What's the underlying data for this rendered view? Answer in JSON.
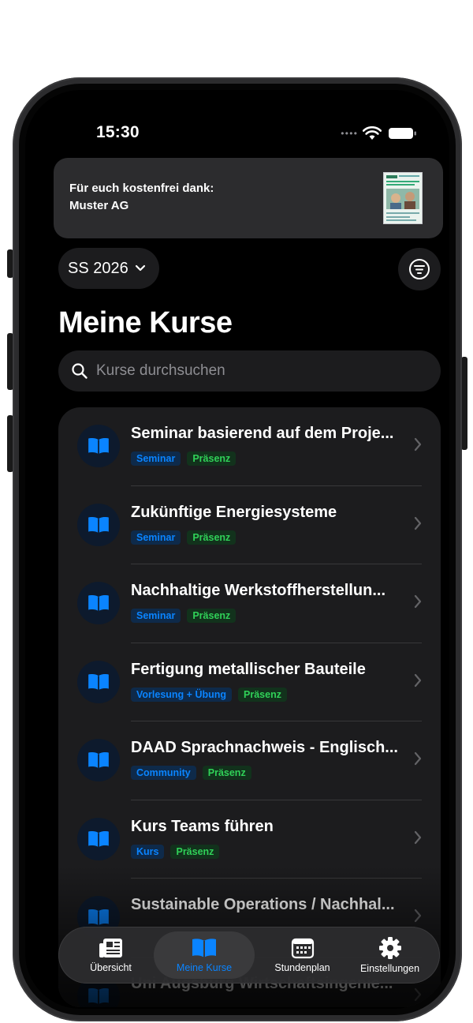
{
  "status": {
    "time": "15:30"
  },
  "sponsor": {
    "line1": "Für euch kostenfrei dank:",
    "line2": "Muster AG"
  },
  "semester": {
    "label": "SS 2026"
  },
  "page": {
    "title": "Meine Kurse"
  },
  "search": {
    "placeholder": "Kurse durchsuchen"
  },
  "courses": [
    {
      "title": "Seminar basierend auf dem Proje...",
      "tags": [
        "Seminar",
        "Präsenz"
      ]
    },
    {
      "title": "Zukünftige Energiesysteme",
      "tags": [
        "Seminar",
        "Präsenz"
      ]
    },
    {
      "title": "Nachhaltige Werkstoffherstellun...",
      "tags": [
        "Seminar",
        "Präsenz"
      ]
    },
    {
      "title": "Fertigung metallischer Bauteile",
      "tags": [
        "Vorlesung + Übung",
        "Präsenz"
      ]
    },
    {
      "title": "DAAD Sprachnachweis - Englisch...",
      "tags": [
        "Community",
        "Präsenz"
      ]
    },
    {
      "title": "Kurs Teams führen",
      "tags": [
        "Kurs",
        "Präsenz"
      ]
    },
    {
      "title": "Sustainable Operations / Nachhal...",
      "tags": []
    },
    {
      "title": "Uni Augsburg Wirtschaftsingenie...",
      "tags": []
    }
  ],
  "tabs": [
    {
      "label": "Übersicht",
      "icon": "newspaper-icon"
    },
    {
      "label": "Meine Kurse",
      "icon": "book-icon"
    },
    {
      "label": "Stundenplan",
      "icon": "calendar-icon"
    },
    {
      "label": "Einstellungen",
      "icon": "gear-icon"
    }
  ],
  "colors": {
    "accent": "#0a84ff",
    "green": "#30d158",
    "card": "#1c1c1e"
  }
}
